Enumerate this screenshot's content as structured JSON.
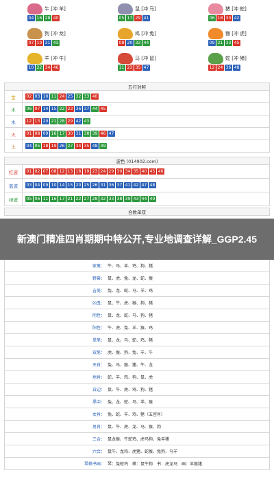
{
  "zodiacs": [
    {
      "name": "牛 [冲 羊]",
      "color": "#d96a8a",
      "balls": [
        {
          "n": "04",
          "c": "blue"
        },
        {
          "n": "16",
          "c": "green"
        },
        {
          "n": "28",
          "c": "green"
        },
        {
          "n": "40",
          "c": "red"
        }
      ]
    },
    {
      "name": "鼠 [冲 马]",
      "color": "#8f8faf",
      "balls": [
        {
          "n": "05",
          "c": "green"
        },
        {
          "n": "17",
          "c": "green"
        },
        {
          "n": "29",
          "c": "red"
        },
        {
          "n": "41",
          "c": "blue"
        }
      ]
    },
    {
      "name": "猪 [冲 蛇]",
      "color": "#e88aa0",
      "balls": [
        {
          "n": "06",
          "c": "green"
        },
        {
          "n": "18",
          "c": "red"
        },
        {
          "n": "30",
          "c": "red"
        },
        {
          "n": "42",
          "c": "blue"
        }
      ]
    },
    {
      "name": "狗 [冲 龙]",
      "color": "#c9924d",
      "balls": [
        {
          "n": "07",
          "c": "red"
        },
        {
          "n": "19",
          "c": "red"
        },
        {
          "n": "31",
          "c": "blue"
        },
        {
          "n": "43",
          "c": "green"
        }
      ]
    },
    {
      "name": "鸡 [冲 兔]",
      "color": "#e7a62b",
      "balls": [
        {
          "n": "08",
          "c": "red"
        },
        {
          "n": "20",
          "c": "blue"
        },
        {
          "n": "32",
          "c": "green"
        },
        {
          "n": "44",
          "c": "green"
        }
      ]
    },
    {
      "name": "猴 [冲 虎]",
      "color": "#f08a2a",
      "balls": [
        {
          "n": "09",
          "c": "blue"
        },
        {
          "n": "21",
          "c": "green"
        },
        {
          "n": "33",
          "c": "green"
        },
        {
          "n": "45",
          "c": "red"
        }
      ]
    },
    {
      "name": "羊 [冲 牛]",
      "color": "#e6b42a",
      "balls": [
        {
          "n": "10",
          "c": "blue"
        },
        {
          "n": "22",
          "c": "green"
        },
        {
          "n": "34",
          "c": "red"
        },
        {
          "n": "46",
          "c": "red"
        }
      ]
    },
    {
      "name": "马 [冲 鼠]",
      "color": "#d64a3a",
      "balls": [
        {
          "n": "11",
          "c": "green"
        },
        {
          "n": "23",
          "c": "red"
        },
        {
          "n": "35",
          "c": "red"
        },
        {
          "n": "47",
          "c": "blue"
        }
      ]
    },
    {
      "name": "蛇 [冲 猪]",
      "color": "#5aa24a",
      "balls": [
        {
          "n": "12",
          "c": "red"
        },
        {
          "n": "24",
          "c": "red"
        },
        {
          "n": "36",
          "c": "blue"
        },
        {
          "n": "48",
          "c": "blue"
        }
      ]
    }
  ],
  "wuxing": {
    "title": "五行对照",
    "rows": [
      {
        "label": "金",
        "lc": "#d1a21a",
        "balls": [
          {
            "n": "02",
            "c": "red"
          },
          {
            "n": "03",
            "c": "blue"
          },
          {
            "n": "10",
            "c": "blue"
          },
          {
            "n": "11",
            "c": "green"
          },
          {
            "n": "24",
            "c": "red"
          },
          {
            "n": "25",
            "c": "blue"
          },
          {
            "n": "32",
            "c": "green"
          },
          {
            "n": "33",
            "c": "green"
          },
          {
            "n": "40",
            "c": "red"
          }
        ]
      },
      {
        "label": "木",
        "lc": "#2f9a3f",
        "balls": [
          {
            "n": "06",
            "c": "green"
          },
          {
            "n": "07",
            "c": "red"
          },
          {
            "n": "14",
            "c": "blue"
          },
          {
            "n": "15",
            "c": "blue"
          },
          {
            "n": "22",
            "c": "green"
          },
          {
            "n": "23",
            "c": "red"
          },
          {
            "n": "36",
            "c": "blue"
          },
          {
            "n": "37",
            "c": "blue"
          },
          {
            "n": "44",
            "c": "green"
          },
          {
            "n": "45",
            "c": "red"
          }
        ]
      },
      {
        "label": "水",
        "lc": "#2d63b8",
        "balls": [
          {
            "n": "12",
            "c": "red"
          },
          {
            "n": "13",
            "c": "red"
          },
          {
            "n": "20",
            "c": "blue"
          },
          {
            "n": "21",
            "c": "green"
          },
          {
            "n": "28",
            "c": "green"
          },
          {
            "n": "29",
            "c": "red"
          },
          {
            "n": "42",
            "c": "blue"
          },
          {
            "n": "43",
            "c": "green"
          }
        ]
      },
      {
        "label": "火",
        "lc": "#d9362b",
        "balls": [
          {
            "n": "01",
            "c": "red"
          },
          {
            "n": "08",
            "c": "red"
          },
          {
            "n": "09",
            "c": "blue"
          },
          {
            "n": "16",
            "c": "green"
          },
          {
            "n": "17",
            "c": "green"
          },
          {
            "n": "30",
            "c": "red"
          },
          {
            "n": "31",
            "c": "blue"
          },
          {
            "n": "38",
            "c": "green"
          },
          {
            "n": "39",
            "c": "green"
          },
          {
            "n": "46",
            "c": "red"
          },
          {
            "n": "47",
            "c": "blue"
          }
        ]
      },
      {
        "label": "土",
        "lc": "#c9924d",
        "balls": [
          {
            "n": "04",
            "c": "blue"
          },
          {
            "n": "05",
            "c": "green"
          },
          {
            "n": "18",
            "c": "red"
          },
          {
            "n": "19",
            "c": "red"
          },
          {
            "n": "26",
            "c": "blue"
          },
          {
            "n": "27",
            "c": "green"
          },
          {
            "n": "34",
            "c": "red"
          },
          {
            "n": "35",
            "c": "red"
          },
          {
            "n": "48",
            "c": "blue"
          },
          {
            "n": "49",
            "c": "green"
          }
        ]
      }
    ]
  },
  "bose": {
    "title": "波色 (014902.com)",
    "rows": [
      {
        "label": "红波",
        "lc": "#d9362b",
        "balls": [
          "01",
          "02",
          "07",
          "08",
          "12",
          "13",
          "18",
          "19",
          "23",
          "24",
          "29",
          "30",
          "34",
          "35",
          "40",
          "45",
          "46"
        ],
        "c": "red"
      },
      {
        "label": "蓝波",
        "lc": "#2d63b8",
        "balls": [
          "03",
          "04",
          "09",
          "10",
          "14",
          "15",
          "20",
          "25",
          "26",
          "31",
          "36",
          "37",
          "41",
          "42",
          "47",
          "48"
        ],
        "c": "blue"
      },
      {
        "label": "绿波",
        "lc": "#2f9a3f",
        "balls": [
          "05",
          "06",
          "11",
          "16",
          "17",
          "21",
          "22",
          "27",
          "28",
          "32",
          "33",
          "38",
          "39",
          "43",
          "44",
          "49"
        ],
        "c": "green"
      }
    ]
  },
  "heshu": {
    "title": "合数单双"
  },
  "overlay": "新澳门精准四肖期期中特公开,专业地调查详解_GGP2.45",
  "shengxiao_rows": [
    {
      "lbl": "家禽：",
      "val": "牛、马、羊、鸡、狗、猪"
    },
    {
      "lbl": "野兽：",
      "val": "鼠、虎、兔、龙、蛇、猴"
    },
    {
      "lbl": "吉美：",
      "val": "兔、龙、蛇、马、羊、鸡"
    },
    {
      "lbl": "凶丑：",
      "val": "鼠、牛、虎、猴、狗、猪"
    },
    {
      "lbl": "阴性：",
      "val": "鼠、龙、蛇、马、狗、猪"
    },
    {
      "lbl": "阳性：",
      "val": "牛、虎、兔、羊、猴、鸡"
    },
    {
      "lbl": "单笔：",
      "val": "鼠、龙、马、蛇、鸡、猪"
    },
    {
      "lbl": "双笔：",
      "val": "虎、猴、狗、兔、羊、牛"
    },
    {
      "lbl": "天肖：",
      "val": "兔、马、猴、猪、牛、龙"
    },
    {
      "lbl": "地肖：",
      "val": "蛇、羊、鸡、狗、鼠、虎"
    },
    {
      "lbl": "白边：",
      "val": "鼠、牛、虎、鸡、狗、猪"
    },
    {
      "lbl": "黑中：",
      "val": "兔、龙、蛇、马、羊、猴"
    },
    {
      "lbl": "女肖：",
      "val": "兔、蛇、羊、鸡、猪（五宫肖）"
    },
    {
      "lbl": "男肖：",
      "val": "鼠、牛、虎、龙、马、猴、狗"
    },
    {
      "lbl": "三合：",
      "val": "鼠龙猴、牛蛇鸡、虎马狗、兔羊猪"
    },
    {
      "lbl": "六合：",
      "val": "鼠牛、龙鸡、虎猪、蛇猴、兔狗、马羊"
    },
    {
      "lbl": "琴棋书画：",
      "val": "琴：兔蛇鸡　棋：鼠牛狗　书：虎龙马　画：羊猴猪"
    }
  ]
}
